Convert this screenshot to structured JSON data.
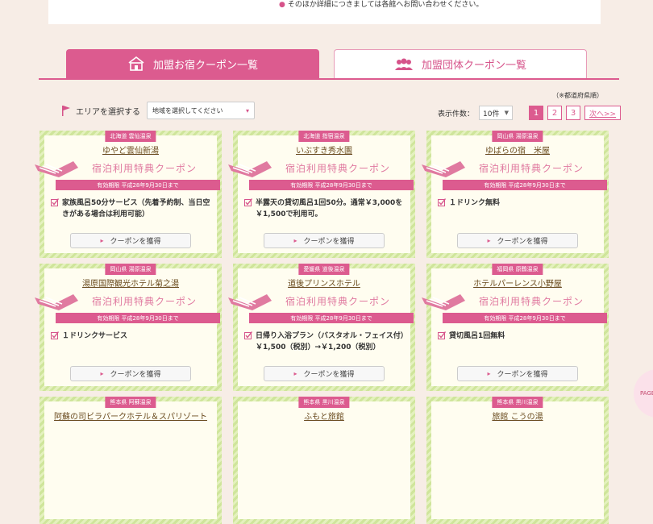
{
  "notice": {
    "text": "そのほか詳細につきましては各館へお問い合わせください。"
  },
  "tabs": [
    {
      "label": "加盟お宿クーポン一覧",
      "icon": "house-icon",
      "active": true
    },
    {
      "label": "加盟団体クーポン一覧",
      "icon": "group-icon",
      "active": false
    }
  ],
  "pref_note": "（※都道府県順）",
  "area": {
    "label": "エリアを選択する",
    "select_value": "地域を選択してください"
  },
  "pager": {
    "count_label": "表示件数：",
    "count_value": "10件",
    "pages": [
      "1",
      "2",
      "3"
    ],
    "current": "1",
    "next_label": "次へ>>"
  },
  "coupon_common": {
    "title": "宿泊利用特典クーポン",
    "button": "クーポンを獲得"
  },
  "cards": [
    {
      "region": "北海道 雲仙温泉",
      "name": "ゆやど雲仙新湯",
      "expiry": "有効期限 平成28年9月30日まで",
      "benefit": "家族風呂50分サービス（先着予約制、当日空きがある場合は利用可能）"
    },
    {
      "region": "北海道 指宿温泉",
      "name": "いぶすき秀水園",
      "expiry": "有効期限 平成28年9月30日まで",
      "benefit": "半露天の貸切風呂1回50分。通常￥3,000を￥1,500で利用可。"
    },
    {
      "region": "岡山県 湯原温泉",
      "name": "ゆばらの宿　米屋",
      "expiry": "有効期限 平成28年9月30日まで",
      "benefit": "１ドリンク無料"
    },
    {
      "region": "岡山県 湯原温泉",
      "name": "湯原国際観光ホテル菊之湯",
      "expiry": "有効期限 平成28年9月30日まで",
      "benefit": "１ドリンクサービス"
    },
    {
      "region": "愛媛県 道後温泉",
      "name": "道後プリンスホテル",
      "expiry": "有効期限 平成28年9月30日まで",
      "benefit": "日帰り入浴プラン（バスタオル・フェイス付）￥1,500（税別）→￥1,200（税別）"
    },
    {
      "region": "福岡県 原鶴温泉",
      "name": "ホテルパーレンス小野屋",
      "expiry": "有効期限 平成28年9月30日まで",
      "benefit": "貸切風呂1回無料"
    },
    {
      "region": "熊本県 阿蘇温泉",
      "name": "阿蘇の司ビラパークホテル＆スパリゾート",
      "expiry": "",
      "benefit": ""
    },
    {
      "region": "熊本県 黒川温泉",
      "name": "ふもと旅館",
      "expiry": "",
      "benefit": ""
    },
    {
      "region": "熊本県 黒川温泉",
      "name": "旅館 こうの湯",
      "expiry": "",
      "benefit": ""
    }
  ],
  "side_badge": "PAGE",
  "colors": {
    "accent": "#dc5b8f",
    "card_stripe": "#cfe59b",
    "background": "#f7ede6"
  }
}
